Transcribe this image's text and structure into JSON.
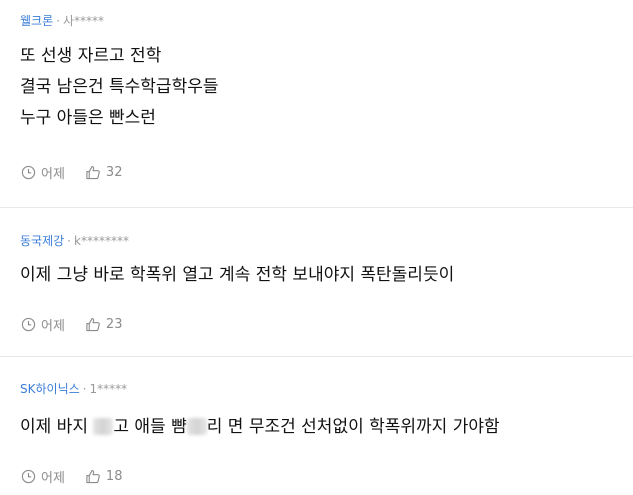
{
  "comments": [
    {
      "nickname": "웰크론",
      "user_id": "사*****",
      "lines": [
        "또 선생 자르고 전학",
        "결국 남은건 특수학급학우들",
        "누구 아들은 빤스런"
      ],
      "time": "어제",
      "likes": "32"
    },
    {
      "nickname": "동국제강",
      "user_id": "k********",
      "lines": [
        "이제 그냥 바로 학폭위 열고 계속 전학 보내야지 폭탄돌리듯이"
      ],
      "time": "어제",
      "likes": "23"
    },
    {
      "nickname": "SK하이닉스",
      "user_id": "1*****",
      "segments": [
        "이제 바지 ",
        "고 애들 뺨",
        "리 면 무조건 선처없이 학폭위까지 가야함"
      ],
      "time": "어제",
      "likes": "18"
    }
  ],
  "colors": {
    "nickname": "#3b7dd8",
    "meta": "#9a9a9a",
    "body": "#111111",
    "divider": "#e9e9e9"
  },
  "icons": {
    "time": "clock-icon",
    "like": "thumbs-up-icon"
  }
}
